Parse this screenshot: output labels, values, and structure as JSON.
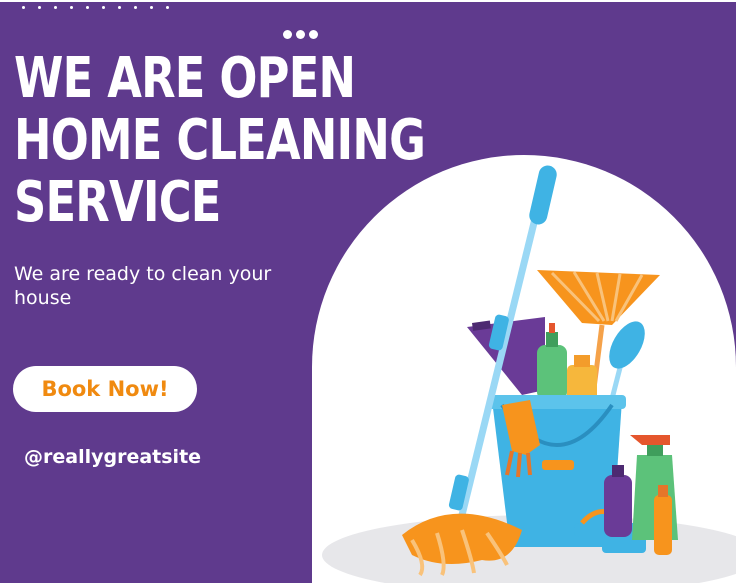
{
  "headline": {
    "lines": [
      "WE ARE OPEN",
      "HOME CLEANING",
      "SERVICE"
    ]
  },
  "subtitle": "We are ready to clean your house",
  "cta": {
    "label": "Book Now!"
  },
  "website": "@reallygreatsite",
  "colors": {
    "background": "#5f3a8d",
    "text": "#ffffff",
    "button_text": "#f08a10",
    "accent_orange": "#f7941d",
    "accent_blue": "#3fb3e4",
    "accent_purple": "#6a3b97",
    "accent_green": "#5cc27a"
  },
  "illustration": {
    "items": [
      "mop",
      "bucket",
      "broom",
      "dustpan",
      "scrub-brush",
      "spray-bottle",
      "rubber-glove",
      "sponge",
      "detergent-bottles"
    ]
  }
}
